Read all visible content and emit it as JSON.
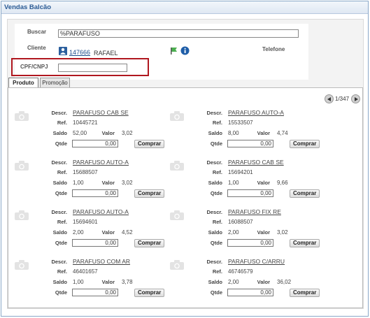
{
  "window": {
    "title": "Vendas Balcão"
  },
  "form": {
    "buscar_label": "Buscar",
    "buscar_value": "%PARAFUSO",
    "cliente_label": "Cliente",
    "cliente_code": "147666",
    "cliente_name": "RAFAEL",
    "telefone_label": "Telefone",
    "cpf_label": "CPF/CNPJ",
    "cpf_value": ""
  },
  "tabs": [
    {
      "label": "Produto",
      "active": true
    },
    {
      "label": "Promoção",
      "active": false
    }
  ],
  "pager": {
    "text": "1/347"
  },
  "field_labels": {
    "descr": "Descr.",
    "ref": "Ref.",
    "saldo": "Saldo",
    "valor": "Valor",
    "qtde": "Qtde"
  },
  "buy_label": "Comprar",
  "products": [
    {
      "descr": "PARAFUSO CAB SE",
      "ref": "10445721",
      "saldo": "52,00",
      "valor": "3,02",
      "qtde": "0,00"
    },
    {
      "descr": "PARAFUSO AUTO-A",
      "ref": "15533507",
      "saldo": "8,00",
      "valor": "4,74",
      "qtde": "0,00"
    },
    {
      "descr": "PARAFUSO AUTO-A",
      "ref": "15688507",
      "saldo": "1,00",
      "valor": "3,02",
      "qtde": "0,00"
    },
    {
      "descr": "PARAFUSO CAB SE",
      "ref": "15694201",
      "saldo": "1,00",
      "valor": "9,66",
      "qtde": "0,00"
    },
    {
      "descr": "PARAFUSO AUTO-A",
      "ref": "15694601",
      "saldo": "2,00",
      "valor": "4,52",
      "qtde": "0,00"
    },
    {
      "descr": "PARAFUSO FIX RE",
      "ref": "16088507",
      "saldo": "2,00",
      "valor": "3,02",
      "qtde": "0,00"
    },
    {
      "descr": "PARAFUSO COM AR",
      "ref": "46401657",
      "saldo": "1,00",
      "valor": "3,78",
      "qtde": "0,00"
    },
    {
      "descr": "PARAFUSO C/ARRU",
      "ref": "46746579",
      "saldo": "2,00",
      "valor": "36,02",
      "qtde": "0,00"
    }
  ]
}
